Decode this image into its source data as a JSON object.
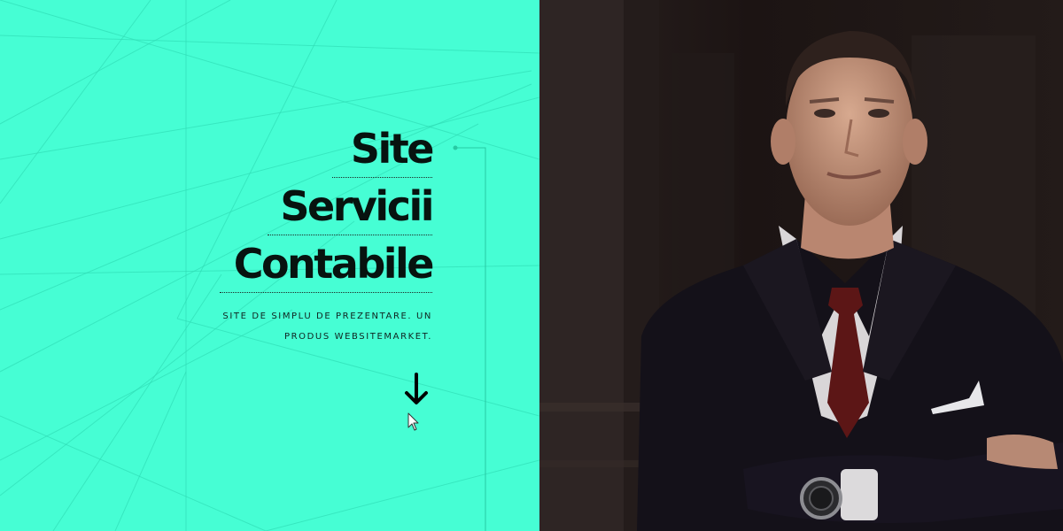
{
  "hero": {
    "title_lines": [
      "Site",
      "Servicii",
      "Contabile"
    ],
    "tagline_lines": [
      "SITE DE SIMPLU DE PREZENTARE. UN",
      "PRODUS WEBSITEMARKET."
    ]
  },
  "icons": {
    "scroll": "arrow-down-icon",
    "pointer": "mouse-cursor-icon"
  },
  "colors": {
    "accent": "#46fed4",
    "text": "#07130f",
    "photo_bg": "#1d1514"
  }
}
